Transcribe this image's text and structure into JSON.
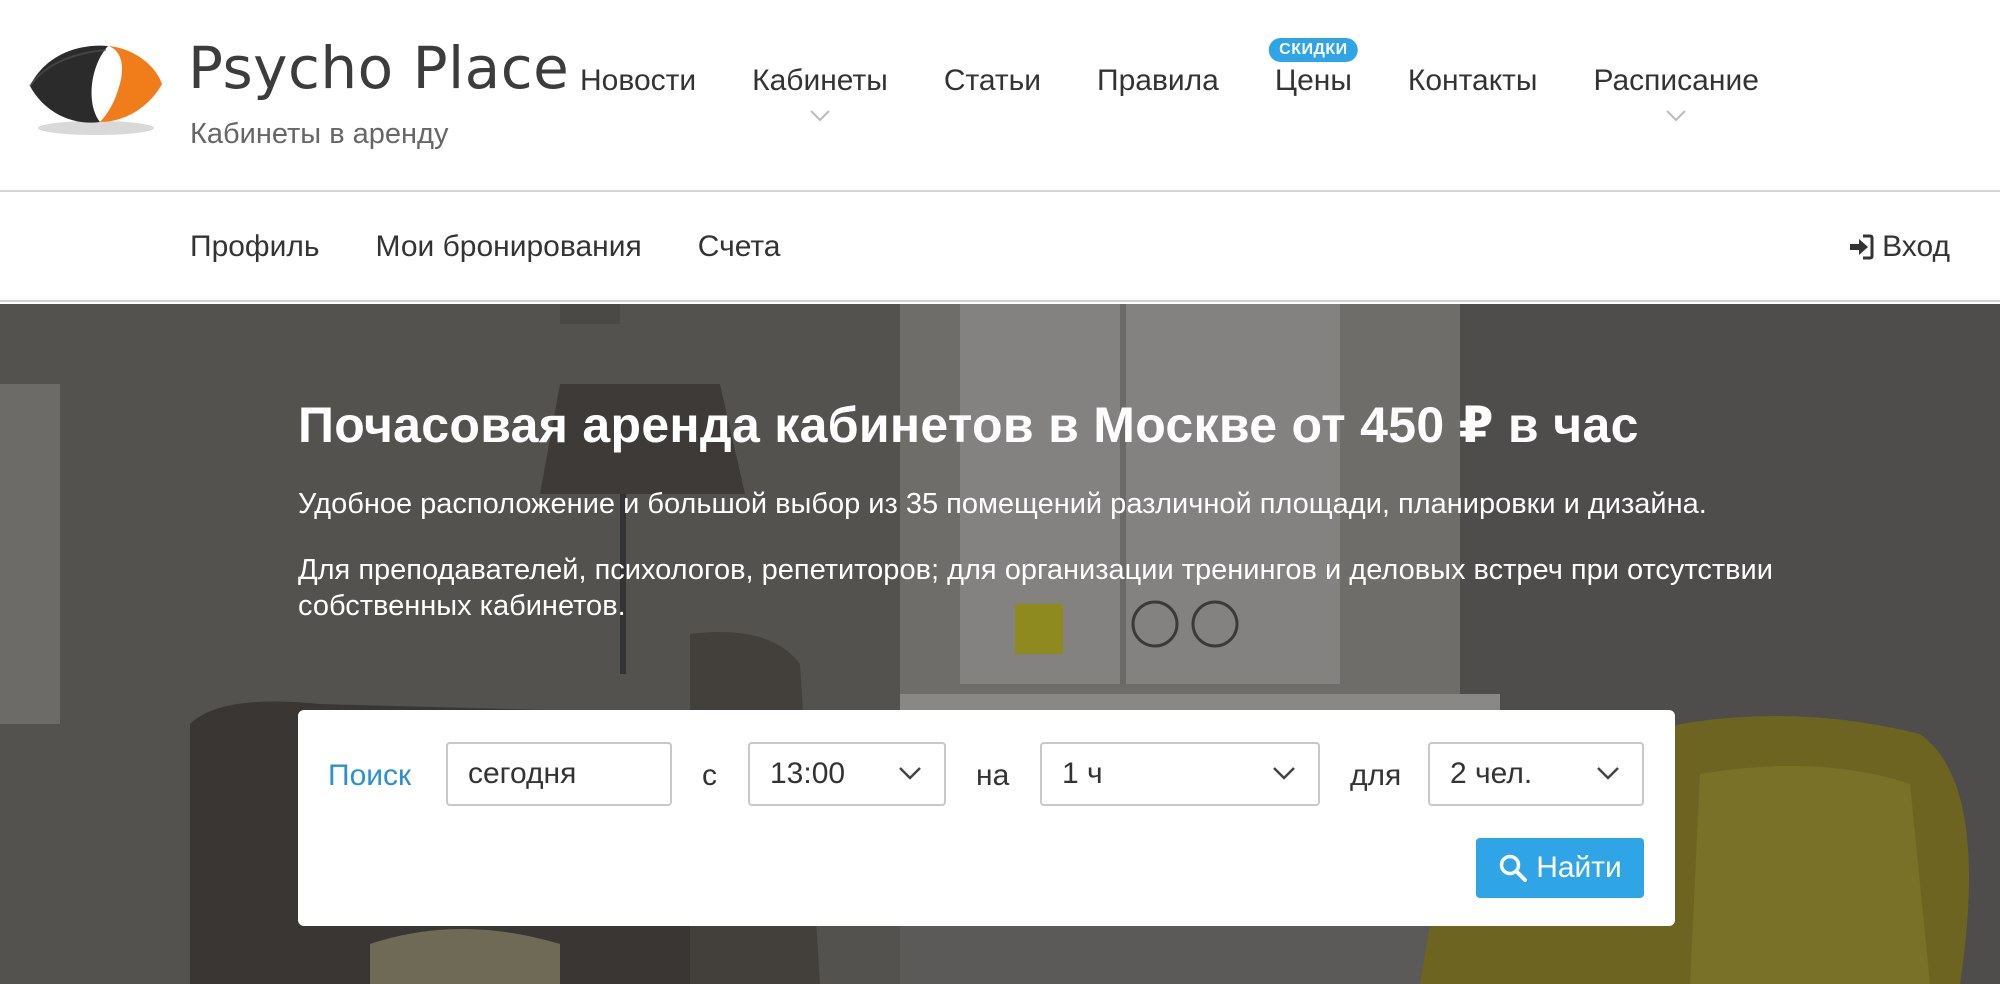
{
  "brand": {
    "title": "Psycho Place",
    "subtitle": "Кабинеты в аренду"
  },
  "main_nav": {
    "items": [
      {
        "label": "Новости",
        "has_dropdown": false
      },
      {
        "label": "Кабинеты",
        "has_dropdown": true
      },
      {
        "label": "Статьи",
        "has_dropdown": false
      },
      {
        "label": "Правила",
        "has_dropdown": false
      },
      {
        "label": "Цены",
        "has_dropdown": false,
        "badge": "СКИДКИ"
      },
      {
        "label": "Контакты",
        "has_dropdown": false
      },
      {
        "label": "Расписание",
        "has_dropdown": true
      }
    ]
  },
  "sub_nav": {
    "items": [
      {
        "label": "Профиль"
      },
      {
        "label": "Мои бронирования"
      },
      {
        "label": "Счета"
      }
    ],
    "login_label": "Вход",
    "login_icon": "sign-in-icon"
  },
  "hero": {
    "title": "Почасовая аренда кабинетов в Москве от 450 ₽ в час",
    "text_1": "Удобное расположение и большой выбор из 35 помещений различной площади, планировки и дизайна.",
    "text_2": "Для преподавателей, психологов, репетиторов; для организации тренингов и деловых встреч при отсутствии собственных кабинетов."
  },
  "search": {
    "label": "Поиск",
    "date_value": "сегодня",
    "sep_from": "с",
    "time_value": "13:00",
    "sep_for": "на",
    "duration_value": "1 ч",
    "sep_people": "для",
    "people_value": "2 чел.",
    "find_label": "Найти",
    "find_icon": "search-icon"
  },
  "colors": {
    "accent": "#2fa4e7",
    "link": "#2a8fd6",
    "logo_orange": "#f07d1a",
    "logo_dark": "#2b2b2b"
  }
}
